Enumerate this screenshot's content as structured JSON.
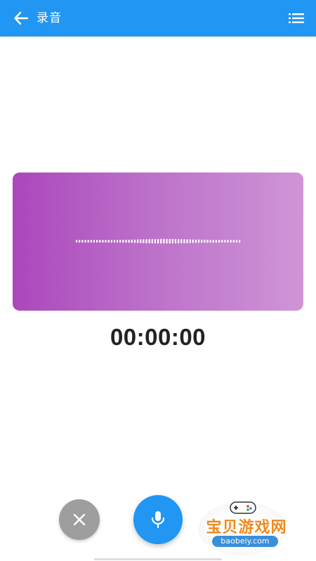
{
  "app_bar": {
    "title": "录音",
    "background": "#2196f3",
    "back_icon": "arrow-left-icon",
    "list_icon": "list-icon"
  },
  "visualizer": {
    "gradient_start": "#ab47bc",
    "gradient_end": "#cf95d6",
    "bar_count": 57
  },
  "timer": {
    "elapsed": "00:00:00"
  },
  "controls": {
    "cancel_icon": "close-icon",
    "cancel_color": "#9e9e9e",
    "record_icon": "microphone-icon",
    "record_color": "#2196f3"
  },
  "watermark": {
    "text": "宝贝游戏网",
    "url": "baobeiy.com",
    "color": "#f08a1e"
  }
}
